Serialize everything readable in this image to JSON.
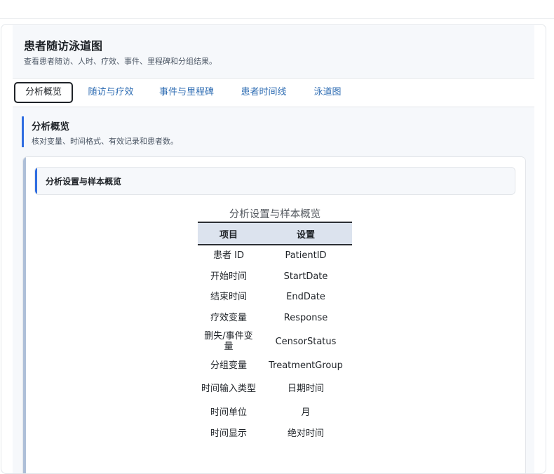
{
  "header": {
    "title": "患者随访泳道图",
    "subtitle": "查看患者随访、人时、疗效、事件、里程碑和分组结果。"
  },
  "tabs": [
    {
      "label": "分析概览",
      "active": true
    },
    {
      "label": "随访与疗效",
      "active": false
    },
    {
      "label": "事件与里程碑",
      "active": false
    },
    {
      "label": "患者时间线",
      "active": false
    },
    {
      "label": "泳道图",
      "active": false
    }
  ],
  "section": {
    "title": "分析概览",
    "subtitle": "核对变量、时间格式、有效记录和患者数。"
  },
  "panel": {
    "title": "分析设置与样本概览"
  },
  "table": {
    "caption": "分析设置与样本概览",
    "columns": [
      "项目",
      "设置"
    ],
    "rows": [
      {
        "item": "患者 ID",
        "value": "PatientID"
      },
      {
        "item": "开始时间",
        "value": "StartDate"
      },
      {
        "item": "结束时间",
        "value": "EndDate"
      },
      {
        "item": "疗效变量",
        "value": "Response"
      },
      {
        "item": "删失/事件变量",
        "value": "CensorStatus"
      },
      {
        "item": "分组变量",
        "value": "TreatmentGroup"
      },
      {
        "item": "时间输入类型",
        "value": "日期时间"
      },
      {
        "item": "时间单位",
        "value": "月"
      },
      {
        "item": "时间显示",
        "value": "绝对时间"
      }
    ]
  },
  "colors": {
    "accent": "#2f6de1",
    "tab_link": "#2f6db3",
    "header_bg": "#f6f8fb",
    "table_head_bg": "#dce3ee"
  }
}
